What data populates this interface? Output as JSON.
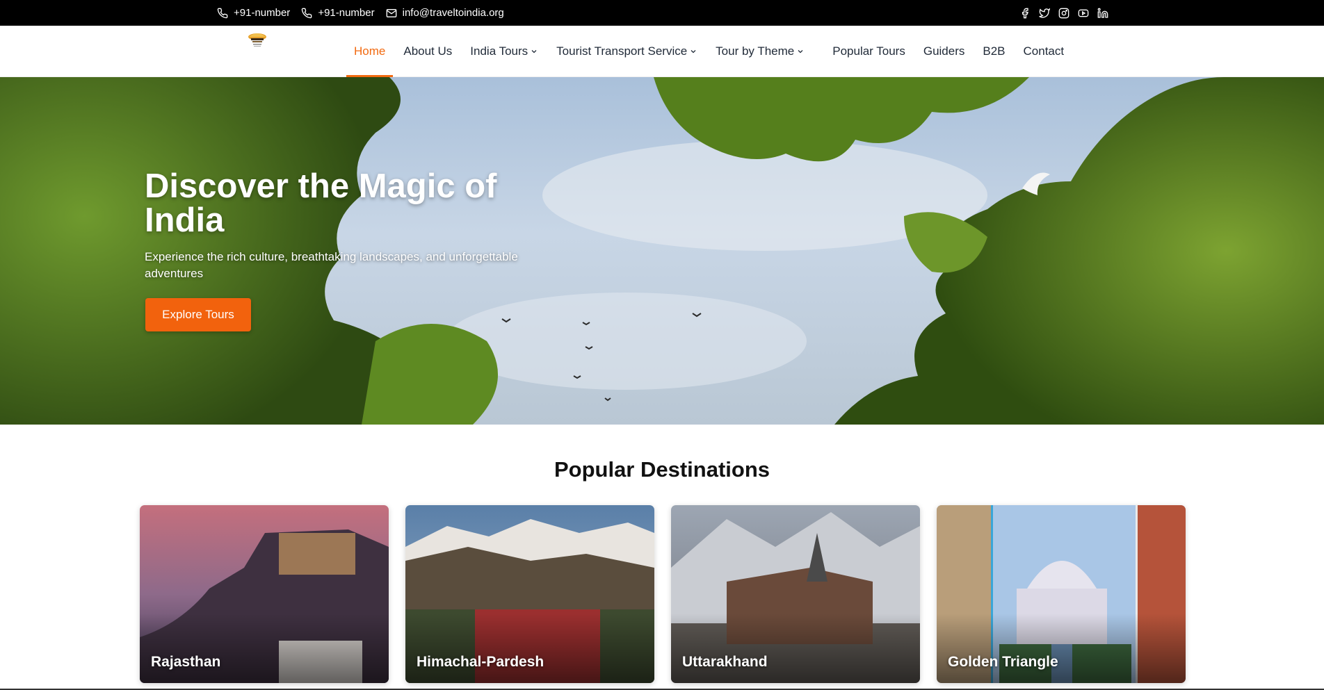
{
  "topbar": {
    "contacts": [
      {
        "icon": "phone-icon",
        "text": "+91-number"
      },
      {
        "icon": "phone-icon",
        "text": "+91-number"
      },
      {
        "icon": "mail-icon",
        "text": "info@traveltoindia.org"
      }
    ],
    "socials": [
      "facebook-icon",
      "twitter-icon",
      "instagram-icon",
      "youtube-icon",
      "linkedin-icon"
    ]
  },
  "nav": {
    "items": [
      {
        "label": "Home",
        "active": true,
        "dropdown": false
      },
      {
        "label": "About Us",
        "dropdown": false
      },
      {
        "label": "India Tours",
        "dropdown": true
      },
      {
        "label": "Tourist Transport Service",
        "dropdown": true
      },
      {
        "label": "Tour by Theme",
        "dropdown": true
      },
      {
        "label": "Popular Tours",
        "dropdown": false
      },
      {
        "label": "Guiders",
        "dropdown": false
      },
      {
        "label": "B2B",
        "dropdown": false
      },
      {
        "label": "Contact",
        "dropdown": false
      }
    ]
  },
  "hero": {
    "title": "Discover the Magic of India",
    "subtitle": "Experience the rich culture, breathtaking landscapes, and unforgettable adventures",
    "button": "Explore Tours"
  },
  "destinations": {
    "title": "Popular Destinations",
    "cards": [
      {
        "name": "Rajasthan"
      },
      {
        "name": "Himachal-Pardesh"
      },
      {
        "name": "Uttarakhand"
      },
      {
        "name": "Golden Triangle"
      }
    ]
  },
  "colors": {
    "accent": "#f26a10",
    "topbar_bg": "#000000"
  }
}
